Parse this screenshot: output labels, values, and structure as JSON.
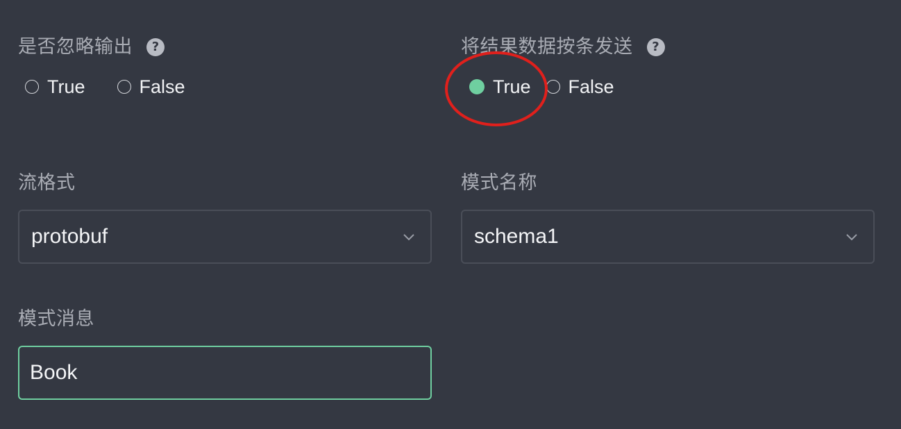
{
  "ignore_output": {
    "label": "是否忽略输出",
    "options": [
      {
        "label": "True",
        "checked": false
      },
      {
        "label": "False",
        "checked": false
      }
    ]
  },
  "send_by_row": {
    "label": "将结果数据按条发送",
    "options": [
      {
        "label": "True",
        "checked": true
      },
      {
        "label": "False",
        "checked": false
      }
    ]
  },
  "stream_format": {
    "label": "流格式",
    "value": "protobuf"
  },
  "schema_name": {
    "label": "模式名称",
    "value": "schema1"
  },
  "schema_message": {
    "label": "模式消息",
    "value": "Book"
  },
  "help_glyph": "?",
  "colors": {
    "accent": "#6fcfa0",
    "background": "#343842",
    "annotation": "#e0201c"
  }
}
